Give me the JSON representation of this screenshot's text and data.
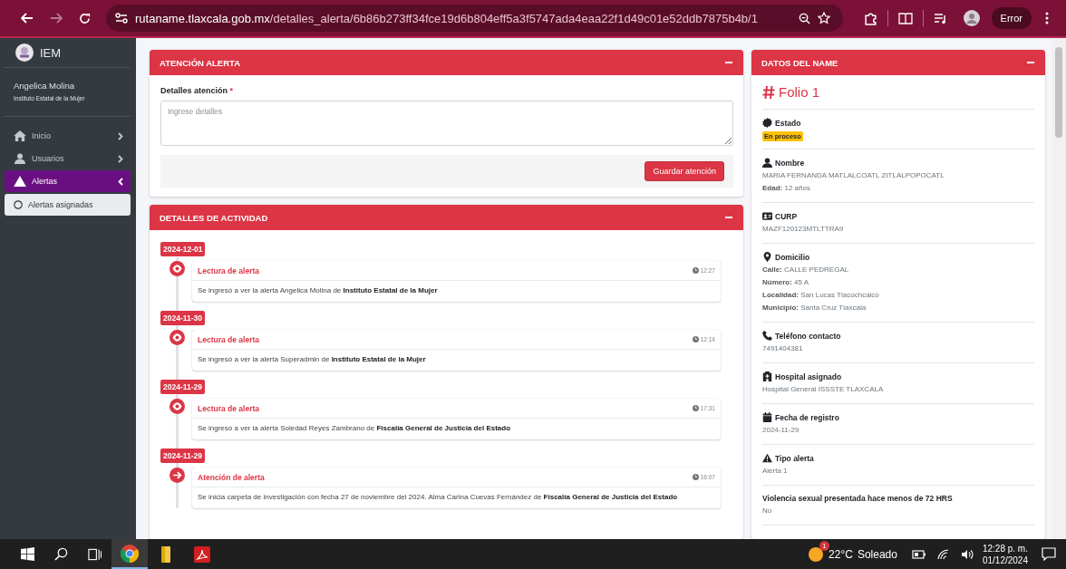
{
  "browser": {
    "url_host": "rutaname.tlaxcala.gob.mx",
    "url_path": "/detalles_alerta/6b86b273ff34fce19d6b804eff5a3f5747ada4eaa22f1d49c01e52ddb7875b4b/1",
    "forward_disabled": true,
    "profile_label": "Error"
  },
  "sidebar": {
    "brand": "IEM",
    "user_name": "Angelica Molina",
    "user_org": "Instituto Estatal de la Mujer",
    "items": [
      {
        "kind": "home",
        "label": "Inicio",
        "expanded": false,
        "selected": false
      },
      {
        "kind": "user",
        "label": "Usuarios",
        "expanded": false,
        "selected": false
      },
      {
        "kind": "warning",
        "label": "Alertas",
        "expanded": true,
        "selected": true,
        "children": [
          {
            "label": "Alertas asignadas",
            "selected": true
          }
        ]
      }
    ]
  },
  "attention_card": {
    "title": "ATENCIÓN ALERTA",
    "field_label": "Detalles atención",
    "required_mark": "*",
    "placeholder": "Ingrese detalles",
    "button": "Guardar atención"
  },
  "activity_card": {
    "title": "DETALLES DE ACTIVIDAD",
    "entries": [
      {
        "date": "2024-12-01",
        "kind": "read",
        "title": "Lectura de alerta",
        "time": "12:27",
        "text": "Se ingresó a ver la alerta Angelica Molina de **Instituto Estatal de la Mujer**"
      },
      {
        "date": "2024-11-30",
        "kind": "read",
        "title": "Lectura de alerta",
        "time": "12:14",
        "text": "Se ingresó a ver la alerta Superadmin de **Instituto Estatal de la Mujer**"
      },
      {
        "date": "2024-11-29",
        "kind": "read",
        "title": "Lectura de alerta",
        "time": "17:31",
        "text": "Se ingresó a ver la alerta Soledad Reyes Zambrano de **Fiscalía General de Justicia del Estado**"
      },
      {
        "date": "2024-11-29",
        "kind": "attention",
        "title": "Atención de alerta",
        "time": "16:07",
        "text": "Se inicia carpeta de investigación con fecha 27 de noviembre del 2024. Alma Carina Cuevas Fernández de **Fiscalía General de Justicia del Estado**"
      }
    ]
  },
  "details_card": {
    "title": "DATOS DEL NAME",
    "folio": "Folio 1",
    "sections": [
      {
        "kind": "status",
        "label": "Estado",
        "badge": "En proceso"
      },
      {
        "kind": "person",
        "label": "Nombre",
        "lines": [
          "MARIA FERNANDA MATLALCOATL ZITLALPOPOCATL",
          "**Edad:** 12 años"
        ]
      },
      {
        "kind": "idcard",
        "label": "CURP",
        "lines": [
          "MAZF120123MTLTTRA9"
        ]
      },
      {
        "kind": "location",
        "label": "Domicilio",
        "lines": [
          "**Calle:** CALLE PEDREGAL",
          "**Número:** 45 A",
          "**Localidad:** San Lucas Tlacochcalco",
          "**Municipio:** Santa Cruz Tlaxcala"
        ]
      },
      {
        "kind": "phone",
        "label": "Teléfono contacto",
        "lines": [
          "7491404381"
        ]
      },
      {
        "kind": "hospital",
        "label": "Hospital asignado",
        "lines": [
          "Hospital General ISSSTE TLAXCALA"
        ]
      },
      {
        "kind": "calendar",
        "label": "Fecha de registro",
        "lines": [
          "2024-11-29"
        ]
      },
      {
        "kind": "warning",
        "label": "Tipo alerta",
        "lines": [
          "Alerta 1"
        ]
      },
      {
        "kind": "plain",
        "label": "Violencia sexual presentada hace menos de 72 HRS",
        "lines": [
          "No"
        ]
      }
    ]
  },
  "taskbar": {
    "weather_badge": "1",
    "temperature": "22°C",
    "weather": "Soleado",
    "time": "12:28 p. m.",
    "date": "01/12/2024"
  }
}
